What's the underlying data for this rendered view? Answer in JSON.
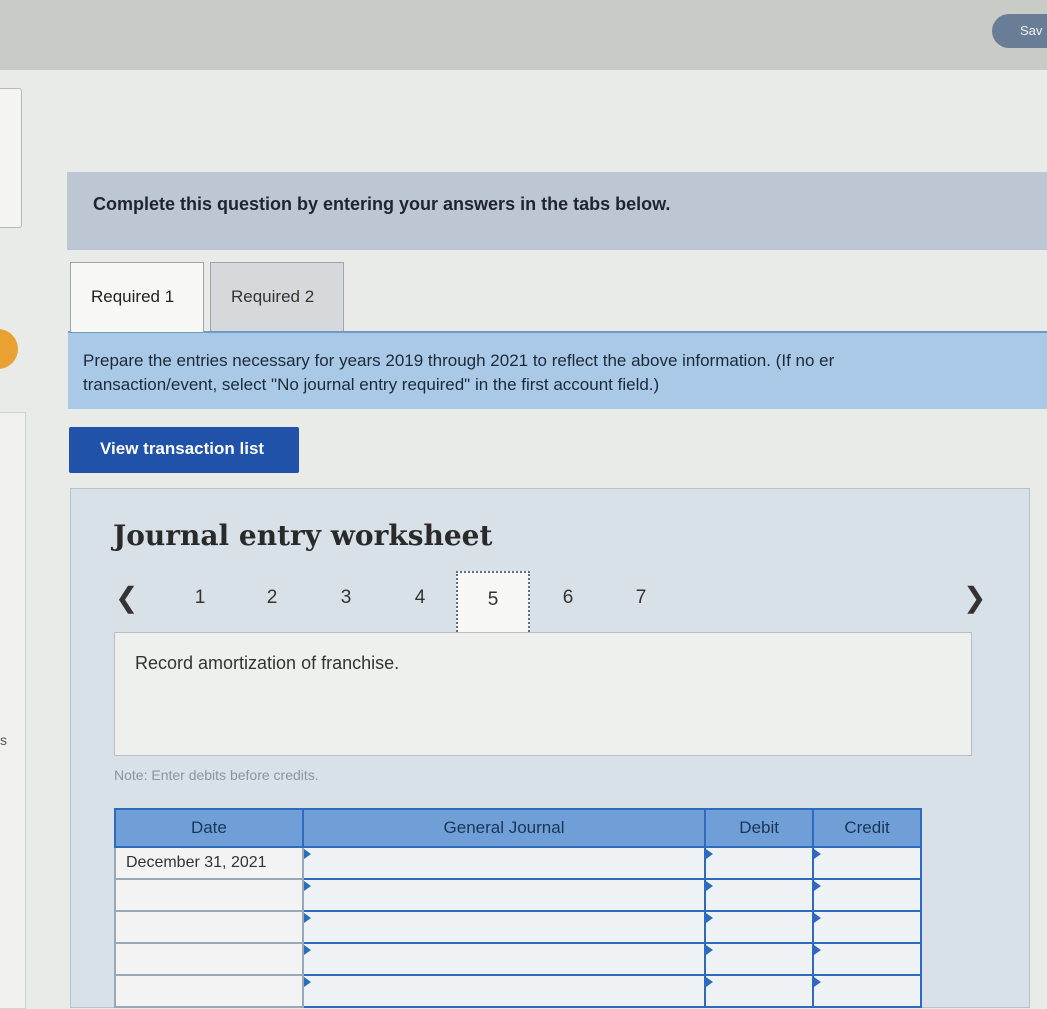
{
  "topbar": {
    "save_label": "Sav"
  },
  "left": {
    "letter": "s"
  },
  "banner": {
    "text": "Complete this question by entering your answers in the tabs below."
  },
  "tabs": [
    {
      "label": "Required 1"
    },
    {
      "label": "Required 2"
    }
  ],
  "instructions": {
    "line1": "Prepare the entries necessary for years 2019 through 2021 to reflect the above information. (If no er",
    "line2": "transaction/event, select \"No journal entry required\" in the first account field.)"
  },
  "view_button": {
    "label": "View transaction list"
  },
  "worksheet": {
    "title": "Journal entry worksheet",
    "pages": [
      "1",
      "2",
      "3",
      "4",
      "5",
      "6",
      "7"
    ],
    "active_page": "5",
    "description": "Record amortization of franchise.",
    "note": "Note: Enter debits before credits."
  },
  "journal": {
    "headers": {
      "date": "Date",
      "general_journal": "General Journal",
      "debit": "Debit",
      "credit": "Credit"
    },
    "rows": [
      {
        "date": "December 31, 2021"
      },
      {
        "date": ""
      },
      {
        "date": ""
      },
      {
        "date": ""
      },
      {
        "date": ""
      }
    ]
  },
  "icons": {
    "prev": "chevron-left-icon",
    "next": "chevron-right-icon"
  }
}
